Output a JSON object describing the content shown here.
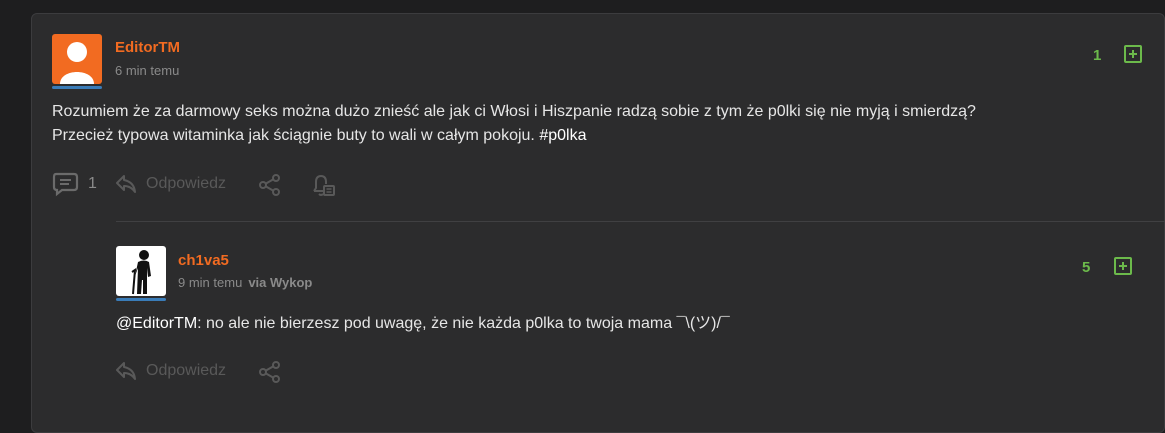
{
  "post": {
    "author": "EditorTM",
    "time": "6 min temu",
    "text_line1": "Rozumiem że za darmowy seks można dużo znieść ale jak ci Włosi i Hiszpanie radzą sobie z tym że p0lki się nie myją i smierdzą?",
    "text_line2": "Przecież typowa witaminka jak ściągnie buty to wali w całym pokoju. ",
    "hashtag": "#p0lka",
    "votes": "1",
    "comment_count": "1",
    "reply_label": "Odpowiedz"
  },
  "comment": {
    "author": "ch1va5",
    "time": "9 min temu",
    "via": "via Wykop",
    "mention": "@EditorTM",
    "text": ": no ale nie bierzesz pod uwagę, że nie każda p0lka to twoja mama ¯\\(ツ)/¯",
    "votes": "5",
    "reply_label": "Odpowiedz"
  },
  "colors": {
    "author": "#f26b21",
    "vote_green": "#6cba4b",
    "background": "#2c2c2d"
  },
  "icons": [
    "avatar-icon",
    "comments-icon",
    "reply-icon",
    "share-icon",
    "notification-icon",
    "plus-icon"
  ]
}
